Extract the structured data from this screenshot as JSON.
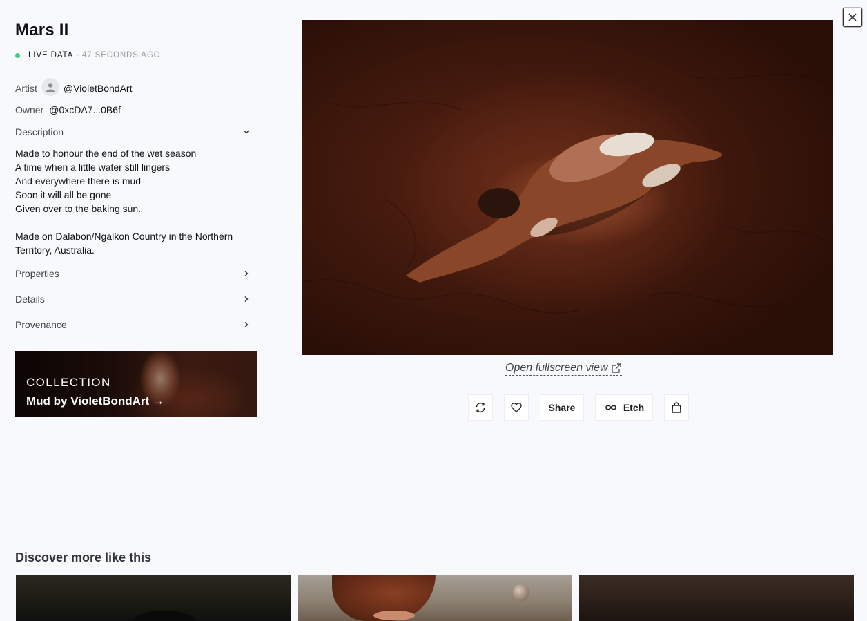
{
  "artwork": {
    "title": "Mars II",
    "live_label": "LIVE DATA",
    "live_separator": "·",
    "live_ago": "47 SECONDS AGO",
    "status_color": "#34d27b"
  },
  "meta": {
    "artist_label": "Artist",
    "artist_handle": "@VioletBondArt",
    "owner_label": "Owner",
    "owner_handle": "@0xcDA7...0B6f"
  },
  "sections": {
    "description_label": "Description",
    "description_text": "Made to honour the end of the wet season\nA time when a little water still lingers\nAnd everywhere there is mud\nSoon it will all be gone\nGiven over to the baking sun.\n\nMade on Dalabon/Ngalkon Country in the Northern Territory, Australia.",
    "properties_label": "Properties",
    "details_label": "Details",
    "provenance_label": "Provenance"
  },
  "collection": {
    "caption": "COLLECTION",
    "name": "Mud by VioletBondArt →"
  },
  "viewer": {
    "fullscreen_link": "Open fullscreen view"
  },
  "actions": {
    "share_label": "Share",
    "etch_label": "Etch"
  },
  "discover": {
    "heading": "Discover more like this"
  },
  "icons": {
    "refresh": "refresh-icon",
    "heart": "heart-icon",
    "infinity": "infinity-icon",
    "bag": "shopping-bag-icon",
    "close": "close-icon",
    "external": "external-link-icon",
    "chevron_down": "chevron-down-icon",
    "chevron_right": "chevron-right-icon",
    "avatar": "user-avatar-icon"
  }
}
